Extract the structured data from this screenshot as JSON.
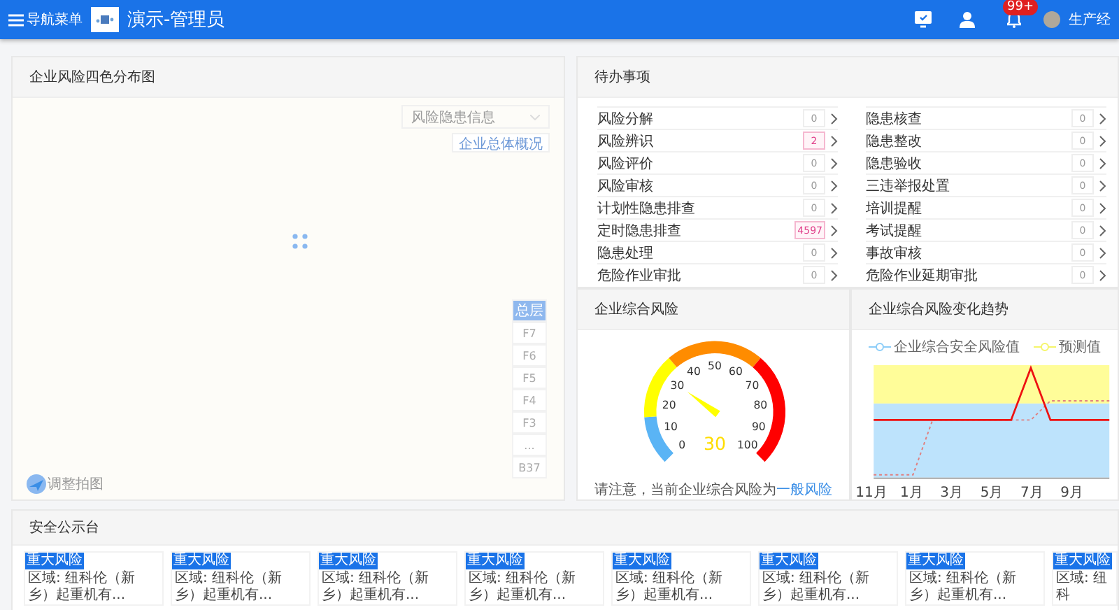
{
  "header": {
    "menu_label": "导航菜单",
    "title": "演示-管理员",
    "notification_badge": "99+",
    "user_name": "生产经"
  },
  "risk_map": {
    "title": "企业风险四色分布图",
    "select_placeholder": "风险隐患信息",
    "overview_button": "企业总体概况",
    "adjust_label": "调整拍图",
    "floors": [
      {
        "label": "总层",
        "selected": true
      },
      {
        "label": "F7",
        "selected": false
      },
      {
        "label": "F6",
        "selected": false
      },
      {
        "label": "F5",
        "selected": false
      },
      {
        "label": "F4",
        "selected": false
      },
      {
        "label": "F3",
        "selected": false
      },
      {
        "label": "...",
        "selected": false
      },
      {
        "label": "B37",
        "selected": false
      }
    ]
  },
  "todo": {
    "title": "待办事项",
    "columns": [
      [
        {
          "label": "风险分解",
          "count": "0",
          "alert": false
        },
        {
          "label": "风险辨识",
          "count": "2",
          "alert": true
        },
        {
          "label": "风险评价",
          "count": "0",
          "alert": false
        },
        {
          "label": "风险审核",
          "count": "0",
          "alert": false
        },
        {
          "label": "计划性隐患排查",
          "count": "0",
          "alert": false
        },
        {
          "label": "定时隐患排查",
          "count": "4597",
          "alert": true
        },
        {
          "label": "隐患处理",
          "count": "0",
          "alert": false
        },
        {
          "label": "危险作业审批",
          "count": "0",
          "alert": false
        }
      ],
      [
        {
          "label": "隐患核查",
          "count": "0",
          "alert": false
        },
        {
          "label": "隐患整改",
          "count": "0",
          "alert": false
        },
        {
          "label": "隐患验收",
          "count": "0",
          "alert": false
        },
        {
          "label": "三违举报处置",
          "count": "0",
          "alert": false
        },
        {
          "label": "培训提醒",
          "count": "0",
          "alert": false
        },
        {
          "label": "考试提醒",
          "count": "0",
          "alert": false
        },
        {
          "label": "事故审核",
          "count": "0",
          "alert": false
        },
        {
          "label": "危险作业延期审批",
          "count": "0",
          "alert": false
        }
      ]
    ]
  },
  "gauge": {
    "title": "企业综合风险",
    "tick_labels": [
      "0",
      "10",
      "20",
      "30",
      "40",
      "50",
      "60",
      "70",
      "80",
      "90",
      "100"
    ],
    "value_text": "30",
    "note": "请注意，当前企业综合风险为",
    "note_link": "一般风险"
  },
  "trend": {
    "title": "企业综合风险变化趋势",
    "legend": [
      {
        "label": "企业综合安全风险值",
        "color": "#8ccdf8"
      },
      {
        "label": "预测值",
        "color": "#f5f56a"
      }
    ],
    "x_labels": [
      "11月",
      "1月",
      "3月",
      "5月",
      "7月",
      "9月"
    ]
  },
  "bulletin": {
    "title": "安全公示台",
    "cards": [
      {
        "tag": "重大风险",
        "text": "区域: 纽科伦（新乡）起重机有..."
      },
      {
        "tag": "重大风险",
        "text": "区域: 纽科伦（新乡）起重机有..."
      },
      {
        "tag": "重大风险",
        "text": "区域: 纽科伦（新乡）起重机有..."
      },
      {
        "tag": "重大风险",
        "text": "区域: 纽科伦（新乡）起重机有..."
      },
      {
        "tag": "重大风险",
        "text": "区域: 纽科伦（新乡）起重机有..."
      },
      {
        "tag": "重大风险",
        "text": "区域: 纽科伦（新乡）起重机有..."
      },
      {
        "tag": "重大风险",
        "text": "区域: 纽科伦（新乡）起重机有..."
      },
      {
        "tag": "重大风险",
        "text": "区域: 纽科"
      }
    ]
  }
}
